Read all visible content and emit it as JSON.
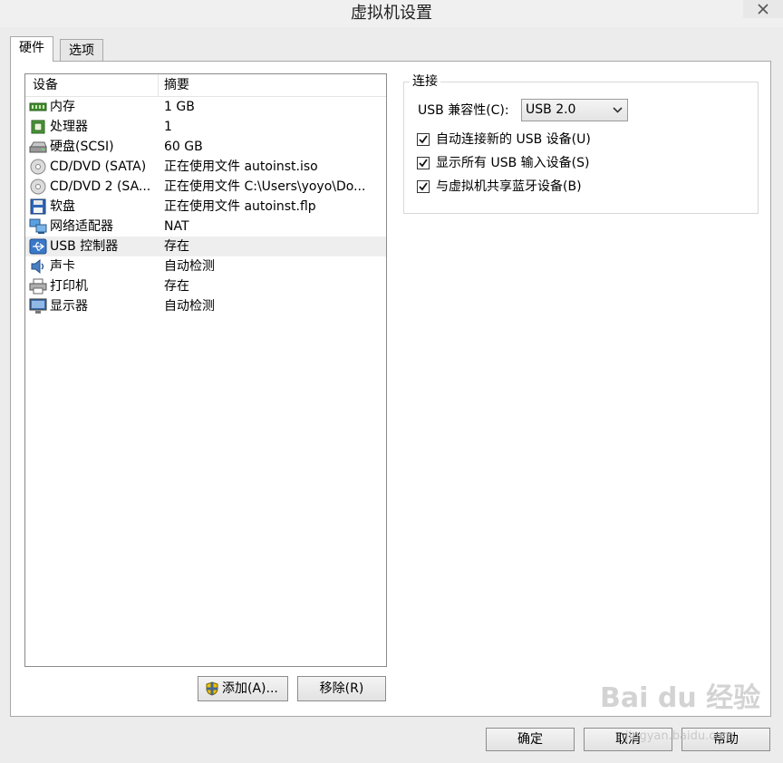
{
  "window": {
    "title": "虚拟机设置"
  },
  "tabs": [
    {
      "label": "硬件",
      "active": true
    },
    {
      "label": "选项",
      "active": false
    }
  ],
  "device_list": {
    "columns": {
      "device": "设备",
      "summary": "摘要"
    },
    "rows": [
      {
        "name": "内存",
        "summary": "1 GB",
        "icon": "memory-icon"
      },
      {
        "name": "处理器",
        "summary": "1",
        "icon": "processor-icon"
      },
      {
        "name": "硬盘(SCSI)",
        "summary": "60 GB",
        "icon": "hard-disk-icon"
      },
      {
        "name": "CD/DVD (SATA)",
        "summary": "正在使用文件 autoinst.iso",
        "icon": "cd-dvd-icon"
      },
      {
        "name": "CD/DVD 2 (SA...",
        "summary": "正在使用文件 C:\\Users\\yoyo\\Do...",
        "icon": "cd-dvd-icon"
      },
      {
        "name": "软盘",
        "summary": "正在使用文件 autoinst.flp",
        "icon": "floppy-icon"
      },
      {
        "name": "网络适配器",
        "summary": "NAT",
        "icon": "network-adapter-icon"
      },
      {
        "name": "USB 控制器",
        "summary": "存在",
        "icon": "usb-icon",
        "selected": true
      },
      {
        "name": "声卡",
        "summary": "自动检测",
        "icon": "sound-card-icon"
      },
      {
        "name": "打印机",
        "summary": "存在",
        "icon": "printer-icon"
      },
      {
        "name": "显示器",
        "summary": "自动检测",
        "icon": "display-icon"
      }
    ]
  },
  "list_buttons": {
    "add_label": "添加(A)...",
    "remove_label": "移除(R)"
  },
  "connection": {
    "legend": "连接",
    "compat_label": "USB 兼容性(C):",
    "compat_value": "USB 2.0",
    "checkboxes": [
      {
        "label": "自动连接新的 USB 设备(U)",
        "checked": true
      },
      {
        "label": "显示所有 USB 输入设备(S)",
        "checked": true
      },
      {
        "label": "与虚拟机共享蓝牙设备(B)",
        "checked": true
      }
    ]
  },
  "footer_buttons": {
    "ok_label": "确定",
    "cancel_label": "取消",
    "help_label": "帮助"
  },
  "watermark": {
    "brand": "Bai du 经验",
    "url": "jingyan.baidu.com"
  },
  "colors": {
    "selected_row": "#eeeeee",
    "panel_bg": "#ffffff",
    "window_bg": "#ececec"
  }
}
